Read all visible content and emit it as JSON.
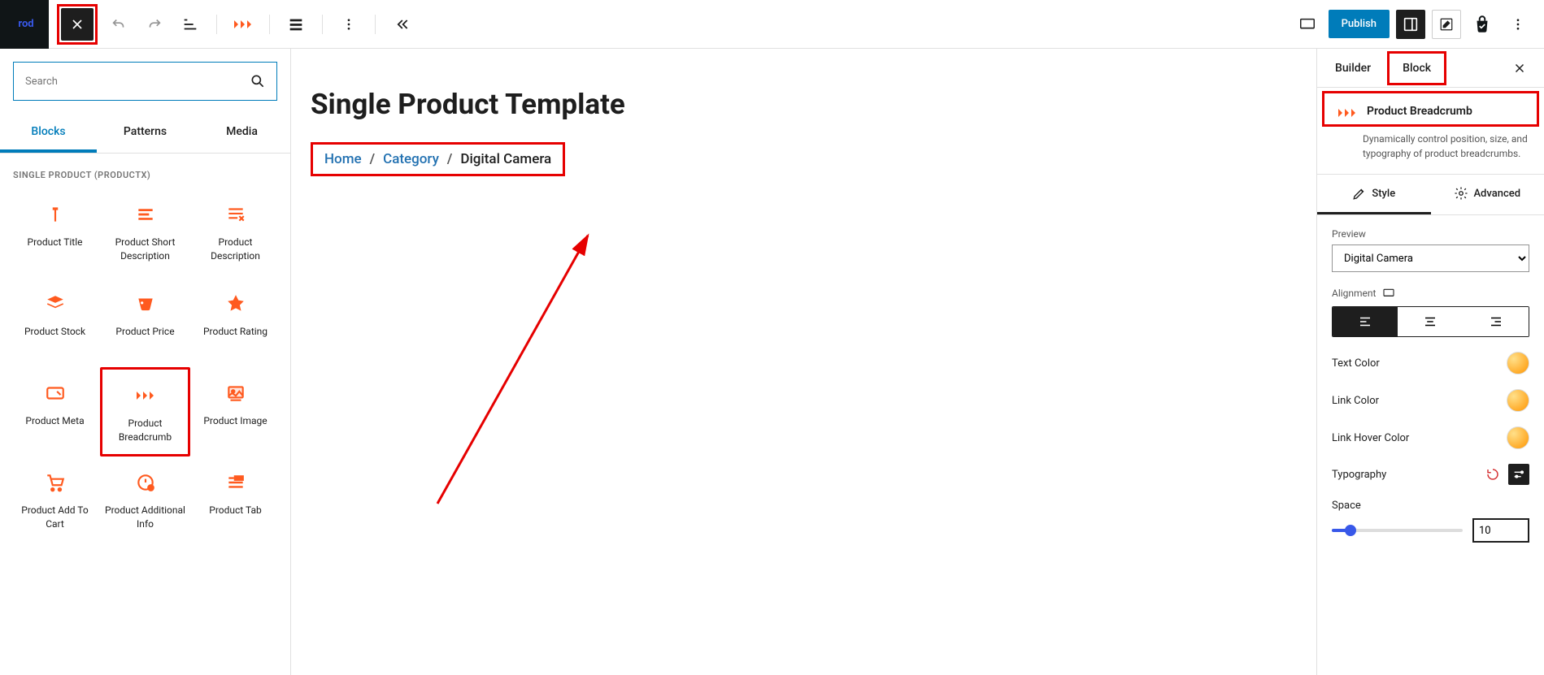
{
  "topbar": {
    "logo_text": "rod",
    "publish_label": "Publish"
  },
  "left": {
    "search_placeholder": "Search",
    "tabs": [
      "Blocks",
      "Patterns",
      "Media"
    ],
    "active_tab": 0,
    "section_label": "SINGLE PRODUCT (PRODUCTX)",
    "blocks": [
      {
        "label": "Product Title"
      },
      {
        "label": "Product Short Description"
      },
      {
        "label": "Product Description"
      },
      {
        "label": "Product Stock"
      },
      {
        "label": "Product Price"
      },
      {
        "label": "Product Rating"
      },
      {
        "label": "Product Meta"
      },
      {
        "label": "Product Breadcrumb",
        "highlighted": true
      },
      {
        "label": "Product Image"
      },
      {
        "label": "Product Add To Cart"
      },
      {
        "label": "Product Additional Info"
      },
      {
        "label": "Product Tab"
      }
    ]
  },
  "canvas": {
    "title": "Single Product Template",
    "breadcrumb": {
      "items": [
        {
          "label": "Home",
          "link": true
        },
        {
          "label": "Category",
          "link": true
        },
        {
          "label": "Digital Camera",
          "link": false
        }
      ],
      "separator": "/"
    }
  },
  "right": {
    "tabs": [
      "Builder",
      "Block"
    ],
    "active_tab": 1,
    "block_title": "Product Breadcrumb",
    "block_desc": "Dynamically control position, size, and typography of product breadcrumbs.",
    "sub_tabs": [
      "Style",
      "Advanced"
    ],
    "active_sub_tab": 0,
    "preview_label": "Preview",
    "preview_value": "Digital Camera",
    "alignment_label": "Alignment",
    "alignment_active": 0,
    "text_color_label": "Text Color",
    "link_color_label": "Link Color",
    "link_hover_label": "Link Hover Color",
    "typography_label": "Typography",
    "space_label": "Space",
    "space_value": "10",
    "space_pct": 14,
    "colors": {
      "accent": "#ff9500"
    }
  }
}
